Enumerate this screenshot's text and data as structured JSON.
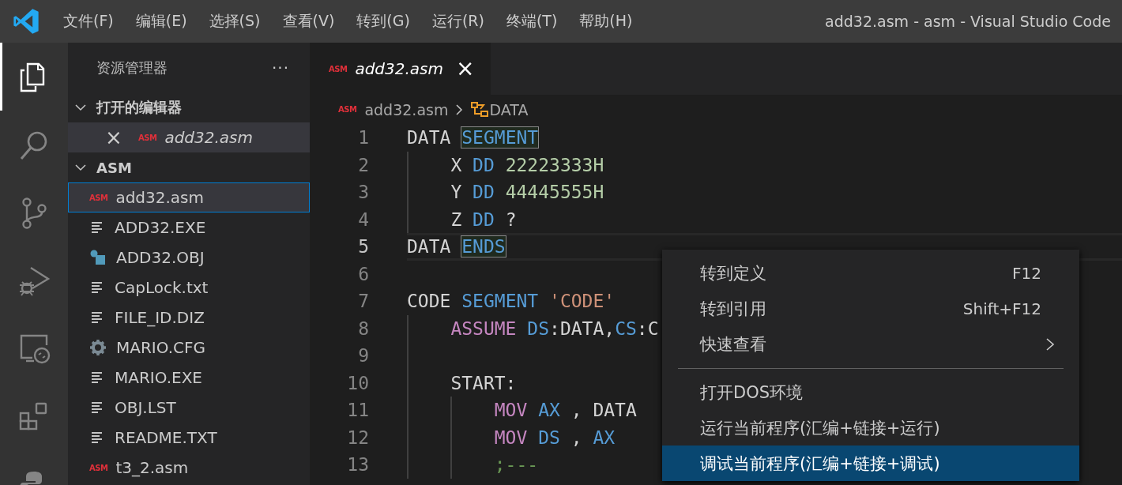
{
  "title_bar": {
    "menus": [
      "文件(F)",
      "编辑(E)",
      "选择(S)",
      "查看(V)",
      "转到(G)",
      "运行(R)",
      "终端(T)",
      "帮助(H)"
    ],
    "title": "add32.asm - asm - Visual Studio Code"
  },
  "activity_bar": [
    {
      "kind": "files",
      "selected": true
    },
    {
      "kind": "search",
      "selected": false
    },
    {
      "kind": "source-control",
      "selected": false
    },
    {
      "kind": "run-debug",
      "selected": false
    },
    {
      "kind": "remote",
      "selected": false
    },
    {
      "kind": "extensions",
      "selected": false
    },
    {
      "kind": "python",
      "selected": false
    }
  ],
  "sidebar": {
    "title": "资源管理器",
    "more": "···",
    "sections": [
      {
        "title": "打开的编辑器",
        "expanded": true,
        "items": [
          {
            "name": "add32.asm",
            "kind": "asm",
            "icon_label": "ASM",
            "preview": true,
            "selected": true,
            "close": "×"
          }
        ]
      },
      {
        "title": "ASM",
        "expanded": true,
        "items": [
          {
            "name": "add32.asm",
            "kind": "asm",
            "icon_label": "ASM",
            "preview": false,
            "selected": true
          },
          {
            "name": "ADD32.EXE",
            "kind": "text",
            "preview": false,
            "selected": false
          },
          {
            "name": "ADD32.OBJ",
            "kind": "object",
            "preview": false,
            "selected": false
          },
          {
            "name": "CapLock.txt",
            "kind": "text",
            "preview": false,
            "selected": false
          },
          {
            "name": "FILE_ID.DIZ",
            "kind": "text",
            "preview": false,
            "selected": false
          },
          {
            "name": "MARIO.CFG",
            "kind": "gear",
            "preview": false,
            "selected": false
          },
          {
            "name": "MARIO.EXE",
            "kind": "text",
            "preview": false,
            "selected": false
          },
          {
            "name": "OBJ.LST",
            "kind": "text",
            "preview": false,
            "selected": false
          },
          {
            "name": "README.TXT",
            "kind": "text",
            "preview": false,
            "selected": false
          },
          {
            "name": "t3_2.asm",
            "kind": "asm",
            "icon_label": "ASM",
            "preview": false,
            "selected": false
          }
        ]
      }
    ]
  },
  "tabs": [
    {
      "name": "add32.asm",
      "icon_label": "ASM",
      "preview": true,
      "selected": true,
      "close": "×"
    }
  ],
  "breadcrumb": {
    "file": "add32.asm",
    "file_icon_label": "ASM",
    "symbol": "DATA"
  },
  "editor": {
    "lines": [
      {
        "number": "1",
        "current": false,
        "tokens": [
          {
            "text": "DATA ",
            "kind": "plain"
          },
          {
            "text": "SEGMENT",
            "kind": "keyword",
            "highlight": true
          }
        ]
      },
      {
        "number": "2",
        "current": false,
        "tokens": [
          {
            "text": "    X ",
            "kind": "plain"
          },
          {
            "text": "DD",
            "kind": "keyword"
          },
          {
            "text": " 22223333H",
            "kind": "number"
          }
        ]
      },
      {
        "number": "3",
        "current": false,
        "tokens": [
          {
            "text": "    Y ",
            "kind": "plain"
          },
          {
            "text": "DD",
            "kind": "keyword"
          },
          {
            "text": " 44445555H",
            "kind": "number"
          }
        ]
      },
      {
        "number": "4",
        "current": false,
        "tokens": [
          {
            "text": "    Z ",
            "kind": "plain"
          },
          {
            "text": "DD",
            "kind": "keyword"
          },
          {
            "text": " ?",
            "kind": "plain"
          }
        ]
      },
      {
        "number": "5",
        "current": true,
        "tokens": [
          {
            "text": "DATA ",
            "kind": "plain"
          },
          {
            "text": "ENDS",
            "kind": "keyword",
            "highlight": true
          }
        ]
      },
      {
        "number": "6",
        "current": false
      },
      {
        "number": "7",
        "current": false,
        "tokens": [
          {
            "text": "CODE ",
            "kind": "plain"
          },
          {
            "text": "SEGMENT",
            "kind": "keyword"
          },
          {
            "text": " 'CODE'",
            "kind": "string"
          }
        ]
      },
      {
        "number": "8",
        "current": false,
        "tokens": [
          {
            "text": "    ASSUME",
            "kind": "instruction"
          },
          {
            "text": " DS",
            "kind": "keyword"
          },
          {
            "text": ":DATA,",
            "kind": "plain"
          },
          {
            "text": "CS",
            "kind": "keyword"
          },
          {
            "text": ":C",
            "kind": "plain"
          }
        ]
      },
      {
        "number": "9",
        "current": false
      },
      {
        "number": "10",
        "current": false,
        "tokens": [
          {
            "text": "    START:",
            "kind": "plain"
          }
        ]
      },
      {
        "number": "11",
        "current": false,
        "tokens": [
          {
            "text": "        MOV",
            "kind": "instruction"
          },
          {
            "text": " AX",
            "kind": "keyword"
          },
          {
            "text": " , DATA",
            "kind": "plain"
          }
        ]
      },
      {
        "number": "12",
        "current": false,
        "tokens": [
          {
            "text": "        MOV",
            "kind": "instruction"
          },
          {
            "text": " DS",
            "kind": "keyword"
          },
          {
            "text": " , ",
            "kind": "plain"
          },
          {
            "text": "AX",
            "kind": "keyword"
          }
        ]
      },
      {
        "number": "13",
        "current": false,
        "tokens": [
          {
            "text": "        ;---",
            "kind": "comment"
          }
        ]
      }
    ]
  },
  "context_menu": [
    {
      "kind": "item",
      "label": "转到定义",
      "shortcut": "F12",
      "selected": false
    },
    {
      "kind": "item",
      "label": "转到引用",
      "shortcut": "Shift+F12",
      "selected": false
    },
    {
      "kind": "submenu",
      "label": "快速查看",
      "selected": false
    },
    {
      "kind": "separator"
    },
    {
      "kind": "item",
      "label": "打开DOS环境",
      "selected": false
    },
    {
      "kind": "item",
      "label": "运行当前程序(汇编+链接+运行)",
      "selected": false
    },
    {
      "kind": "item",
      "label": "调试当前程序(汇编+链接+调试)",
      "selected": true
    }
  ]
}
